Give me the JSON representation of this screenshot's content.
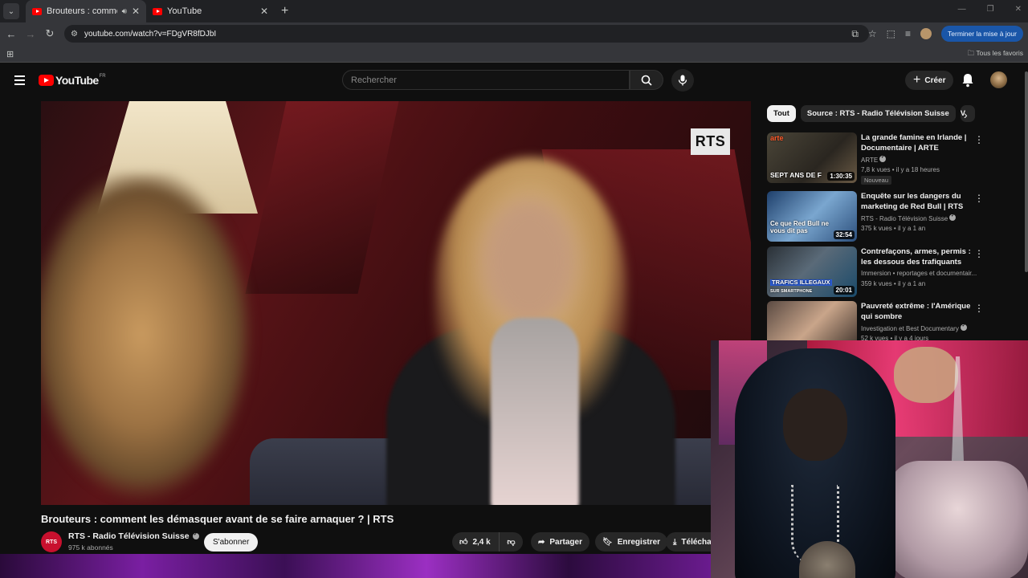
{
  "browser": {
    "tabs": [
      {
        "title": "Brouteurs : comment les dé",
        "active": true,
        "audio": true
      },
      {
        "title": "YouTube",
        "active": false,
        "audio": false
      }
    ],
    "url": "youtube.com/watch?v=FDgVR8fDJbI",
    "update_button": "Terminer la mise à jour",
    "bookmarks_folder": "Tous les favoris"
  },
  "masthead": {
    "logo_text": "YouTube",
    "country_code": "FR",
    "search_placeholder": "Rechercher",
    "create_label": "Créer"
  },
  "video": {
    "watermark": "RTS",
    "title": "Brouteurs : comment les démasquer avant de se faire arnaquer ? | RTS",
    "channel_logo_text": "RTS",
    "channel_name": "RTS - Radio Télévision Suisse",
    "subscribers": "975 k abonnés",
    "subscribe_label": "S'abonner",
    "likes": "2,4 k",
    "share_label": "Partager",
    "save_label": "Enregistrer",
    "download_label": "Téléchar"
  },
  "sidebar": {
    "chips": [
      "Tout",
      "Source : RTS - Radio Télévision Suisse",
      "V"
    ],
    "recommendations": [
      {
        "title": "La grande famine en Irlande | Documentaire | ARTE",
        "channel": "ARTE",
        "meta": "7,8 k vues • il y a 18 heures",
        "badge": "Nouveau",
        "duration": "1:30:35",
        "thumb_caption": "SEPT ANS DE F",
        "thumb_brand": "arte"
      },
      {
        "title": "Enquête sur les dangers du marketing de Red Bull  | RTS",
        "channel": "RTS - Radio Télévision Suisse",
        "meta": "375 k vues • il y a 1 an",
        "duration": "32:54",
        "thumb_caption": "Ce que Red Bull ne vous dit pas"
      },
      {
        "title": "Contrefaçons, armes, permis : les dessous des trafiquants",
        "channel": "Immersion  •  reportages et documentair...",
        "meta": "359 k vues • il y a 1 an",
        "duration": "20:01",
        "thumb_caption": "TRAFICS ILLEGAUX",
        "thumb_subcaption": "SUR SMARTPHONE"
      },
      {
        "title": "Pauvreté extrême : l'Amérique qui sombre",
        "channel": "Investigation  et Best Documentary",
        "meta": "52 k vues • il y a 4 jours"
      }
    ]
  },
  "colors": {
    "yt_red": "#ff0000",
    "rts_red": "#c8102e",
    "bg": "#0f0f0f",
    "update_blue": "#1a56a8"
  }
}
